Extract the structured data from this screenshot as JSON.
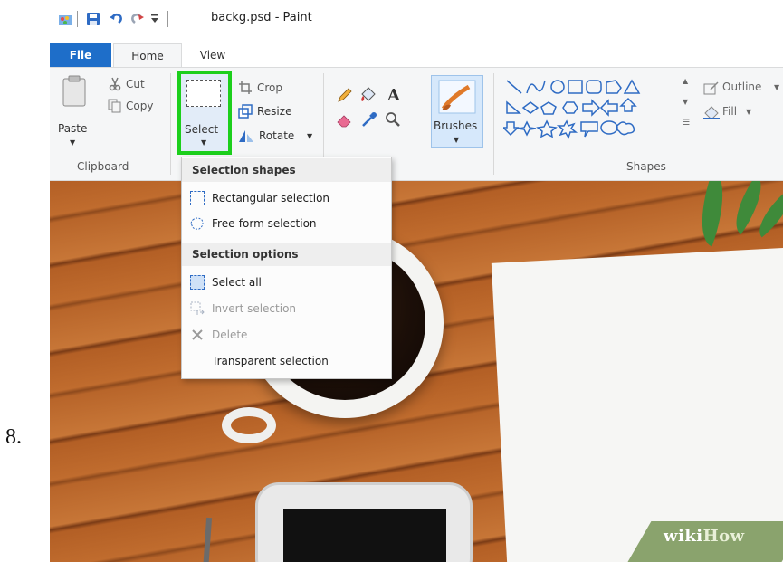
{
  "step_number": "8.",
  "window": {
    "title": "backg.psd - Paint"
  },
  "quick_access": [
    "paint-app-icon",
    "save-icon",
    "undo-icon",
    "redo-icon",
    "customize-dropdown-icon"
  ],
  "tabs": [
    {
      "label": "File",
      "active": false
    },
    {
      "label": "Home",
      "active": true
    },
    {
      "label": "View",
      "active": false
    }
  ],
  "ribbon": {
    "clipboard": {
      "paste_label": "Paste",
      "cut_label": "Cut",
      "copy_label": "Copy",
      "group_label": "Clipboard"
    },
    "image": {
      "select_label": "Select",
      "crop_label": "Crop",
      "resize_label": "Resize",
      "rotate_label": "Rotate"
    },
    "brushes_label": "Brushes",
    "shapes": {
      "group_label": "Shapes",
      "outline_label": "Outline",
      "fill_label": "Fill"
    }
  },
  "select_menu": {
    "header_shapes": "Selection shapes",
    "header_options": "Selection options",
    "items": [
      {
        "label": "Rectangular selection",
        "enabled": true,
        "icon": "rectangular-selection-icon"
      },
      {
        "label": "Free-form selection",
        "enabled": true,
        "icon": "free-form-selection-icon"
      },
      {
        "label": "Select all",
        "enabled": true,
        "icon": "select-all-icon"
      },
      {
        "label": "Invert selection",
        "enabled": false,
        "icon": "invert-selection-icon"
      },
      {
        "label": "Delete",
        "enabled": false,
        "icon": "delete-icon"
      },
      {
        "label": "Transparent selection",
        "enabled": true,
        "icon": ""
      }
    ]
  },
  "watermark": {
    "part1": "wiki",
    "part2": "How"
  },
  "colors": {
    "file_tab": "#1e6ec9",
    "highlight": "#1ccf1c",
    "ribbon_bg": "#f5f6f7"
  }
}
